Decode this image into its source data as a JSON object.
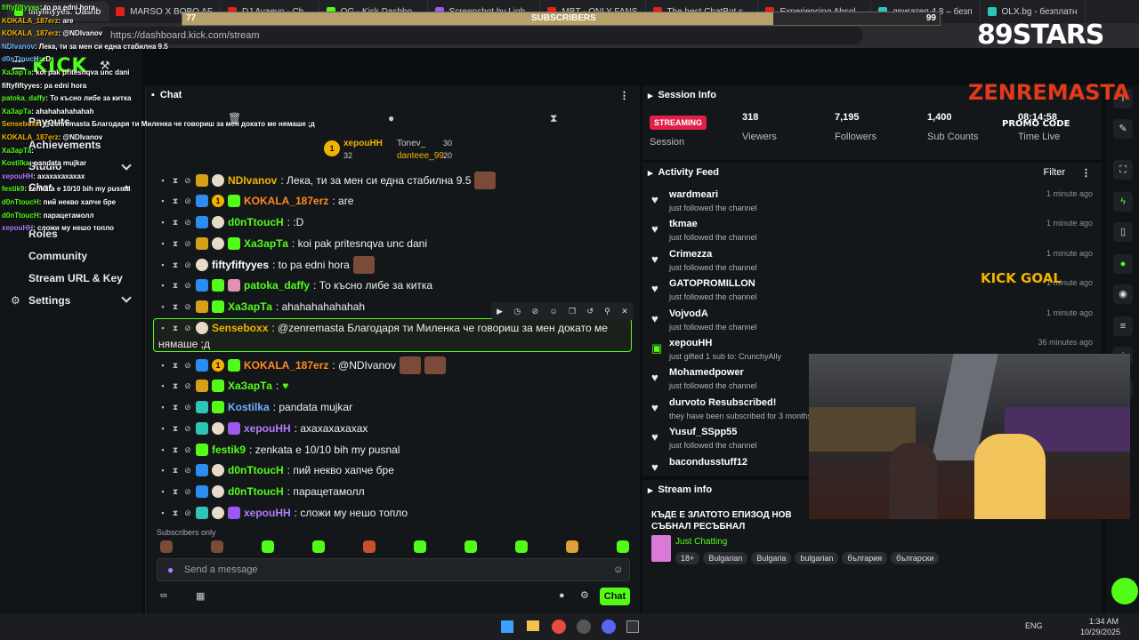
{
  "browser": {
    "tabs": [
      {
        "label": "fiftyfiftyyes: Dashb"
      },
      {
        "label": "MARSO X BOBO AF"
      },
      {
        "label": "DJ Avaevo - Ch..."
      },
      {
        "label": "OG - Kick Dashbo..."
      },
      {
        "label": "Screenshot by Ligh..."
      },
      {
        "label": "MBT - ONLY FANS"
      },
      {
        "label": "The best ChatBot s..."
      },
      {
        "label": "Experiencing Absol..."
      },
      {
        "label": "двигатея 4.8 – безп"
      },
      {
        "label": "OLX.bg - безплатн"
      }
    ],
    "url": "https://dashboard.kick.com/stream"
  },
  "nav": {
    "logo": "KICK",
    "items": [
      "Achievements",
      "Studio",
      "Chat",
      "Roles",
      "Community",
      "Stream URL & Key",
      "Settings"
    ],
    "partial": "Payouts"
  },
  "chat": {
    "title": "Chat",
    "top_gifters": [
      {
        "name": "xepouHH",
        "count": "32"
      },
      {
        "name": "Tonev_",
        "count": "30"
      },
      {
        "name": "danteee_99",
        "count": "20"
      }
    ],
    "messages": [
      {
        "user": "NDIvanov",
        "color": "#f2b300",
        "text": ": Лека, ти за мен си една стабилна 9.5"
      },
      {
        "user": "KOKALA_187erz",
        "color": "#ff8a1f",
        "text": ": are"
      },
      {
        "user": "d0nTtoucH",
        "color": "#53fc18",
        "text": ": :D"
      },
      {
        "user": "ХаЗарТа",
        "color": "#53fc18",
        "text": ": koi pak pritesnqva unc dani"
      },
      {
        "user": "fiftyfiftyyes",
        "color": "#ffffff",
        "text": ": to pa edni hora"
      },
      {
        "user": "patoka_daffy",
        "color": "#53fc18",
        "text": ": То късно либе за китка"
      },
      {
        "user": "ХаЗарТа",
        "color": "#53fc18",
        "text": ": ahahahahahahah"
      },
      {
        "user": "Senseboxx",
        "color": "#f2b300",
        "text": ": @zenremasta Благодаря ти Миленка че говориш за мен докато ме",
        "text2": "нямаше ;д"
      },
      {
        "user": "KOKALA_187erz",
        "color": "#ff8a1f",
        "text": ": @NDIvanov"
      },
      {
        "user": "ХаЗарТа",
        "color": "#53fc18",
        "text": ":"
      },
      {
        "user": "Kostilka",
        "color": "#6fb3ff",
        "text": ": pandata mujkar"
      },
      {
        "user": "xepouHH",
        "color": "#b57cff",
        "text": ": axaxaxaxaxax"
      },
      {
        "user": "festik9",
        "color": "#53fc18",
        "text": ": zenkata e 10/10 bih my pusnal"
      },
      {
        "user": "d0nTtoucH",
        "color": "#53fc18",
        "text": ": пий некво хапче бре"
      },
      {
        "user": "d0nTtoucH",
        "color": "#53fc18",
        "text": ": парацетамолл"
      },
      {
        "user": "xepouHH",
        "color": "#b57cff",
        "text": ": сложи му нешо топло"
      }
    ],
    "subscribers_only": "Subscribers only",
    "input_placeholder": "Send a message",
    "send_label": "Chat"
  },
  "session": {
    "title": "Session Info",
    "badge": "STREAMING",
    "session_label": "Session",
    "viewers": "318",
    "viewers_label": "Viewers",
    "followers": "7,195",
    "followers_label": "Followers",
    "subs": "1,400",
    "subs_label": "Sub Counts",
    "time": "08:14:58",
    "time_label": "Time Live"
  },
  "activity": {
    "title": "Activity Feed",
    "filter": "Filter",
    "items": [
      {
        "name": "wardmeari",
        "sub": "just followed the channel",
        "time": "1 minute ago"
      },
      {
        "name": "tkmae",
        "sub": "just followed the channel",
        "time": "1 minute ago"
      },
      {
        "name": "Crimezza",
        "sub": "just followed the channel",
        "time": "1 minute ago"
      },
      {
        "name": "GATOPROMILLON",
        "sub": "just followed the channel",
        "time": "1 minute ago"
      },
      {
        "name": "VojvodA",
        "sub": "just followed the channel",
        "time": "1 minute ago"
      },
      {
        "name": "xepouHH",
        "sub": "just gifted 1 sub to: CrunchyAlly",
        "time": "36 minutes ago"
      },
      {
        "name": "Mohamedpower",
        "sub": "just followed the channel",
        "time": ""
      },
      {
        "name": "durvoto Resubscribed!",
        "sub": "they have been subscribed for 3 months",
        "time": ""
      },
      {
        "name": "Yusuf_SSpp55",
        "sub": "just followed the channel",
        "time": ""
      },
      {
        "name": "bacondusstuff12",
        "sub": "",
        "time": ""
      }
    ]
  },
  "streaminfo": {
    "title": "Stream info",
    "stream_title": "КЪДЕ Е ЗЛАТОТО ЕПИЗОД НОВ",
    "stream_title2": "СЪБНАЛ РЕСЪБНАЛ",
    "category": "Just Chatting",
    "tags": [
      "18+",
      "Bulgarian",
      "Bulgaria",
      "bulgarian",
      "българия",
      "български"
    ]
  },
  "overlay": {
    "subs_current": "77",
    "subs_goal": "99",
    "subs_progress": 0.78,
    "subs_label": "SUBSCRIBERS",
    "brand": "89STARS",
    "channel_logo": "ZENREMASTA",
    "promo": "PROMO CODE",
    "kick_goal": "KICK GOAL",
    "chat_lines": [
      {
        "user": "fiftyfiftyyes",
        "text": ": to pa edni hora"
      },
      {
        "user": "KOKALA_187erz",
        "text": ": are"
      },
      {
        "user": "KOKALA_187erz",
        "text": ": @NDIvanov"
      },
      {
        "user": "NDIvanov",
        "text": ": Лека, ти за мен си една стабилна 9.5"
      },
      {
        "user": "d0nTtoucH",
        "text": ": :D"
      },
      {
        "user": "ХаЗарТа",
        "text": ": koi pak pritesnqva unc dani"
      },
      {
        "user": "fiftyfiftyyes",
        "text": ": pa edni hora"
      },
      {
        "user": "patoka_daffy",
        "text": ": То късно либе за китка"
      },
      {
        "user": "ХаЗарТа",
        "text": ": ahahahahahahah"
      },
      {
        "user": "Senseboxx",
        "text": ": @zenremasta Благодаря ти Миленка че говориш за мен докато ме нямаше ;д"
      },
      {
        "user": "KOKALA_187erz",
        "text": ": @NDIvanov"
      },
      {
        "user": "ХаЗарТа",
        "text": ":"
      },
      {
        "user": "Kostilka",
        "text": ": pandata mujkar"
      },
      {
        "user": "xepouHH",
        "text": ": axaxaxaxaxax"
      },
      {
        "user": "festik9",
        "text": ": zenkata e 10/10 bih my pusnal"
      },
      {
        "user": "d0nTtoucH",
        "text": ": пий некво хапче бре"
      },
      {
        "user": "d0nTtoucH",
        "text": ": парацетамолл"
      },
      {
        "user": "xepouHH",
        "text": ": сложи му нешо топло"
      }
    ]
  },
  "taskbar": {
    "lang": "ENG",
    "time": "1:34 AM",
    "date": "10/29/2025"
  },
  "colors": {
    "accent": "#53fc18",
    "streaming": "#e0204a"
  }
}
